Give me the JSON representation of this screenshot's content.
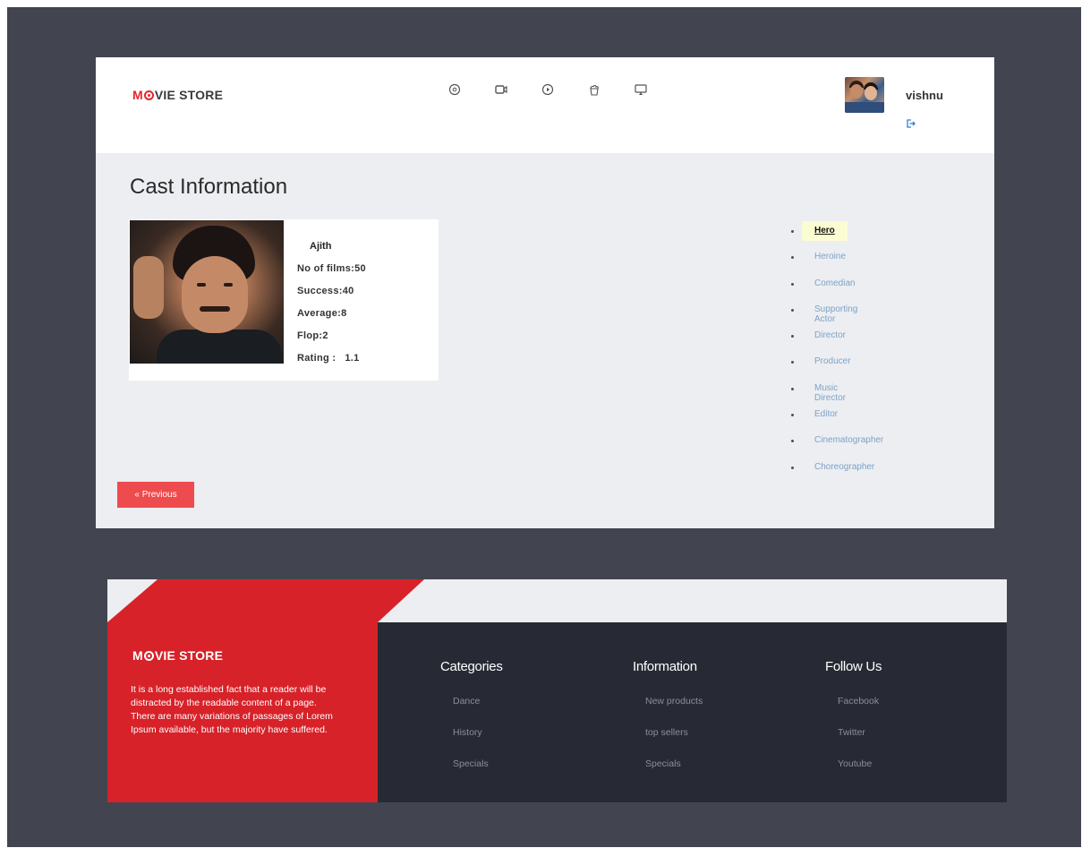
{
  "header": {
    "logo": {
      "m": "M",
      "rest": "VIE STORE"
    },
    "nav_icons": [
      "search-icon",
      "video-camera-icon",
      "play-icon",
      "popcorn-icon",
      "cast-screen-icon"
    ],
    "user": {
      "name": "vishnu",
      "logout_icon": "logout-icon"
    }
  },
  "page": {
    "title": "Cast Information"
  },
  "cast": {
    "name": "Ajith",
    "films": "No of films:50",
    "success": "Success:40",
    "average": "Average:8",
    "flop": "Flop:2",
    "rating_label": "Rating :",
    "rating_value": "1.1"
  },
  "roles": {
    "active": "Hero",
    "items": [
      "Heroine",
      "Comedian",
      "Supporting Actor",
      "Director",
      "Producer",
      "Music Director",
      "Editor",
      "Cinematographer",
      "Choreographer"
    ]
  },
  "buttons": {
    "previous": "« Previous"
  },
  "footer": {
    "logo": {
      "m": "M",
      "rest": "VIE STORE"
    },
    "about": [
      "It is a long established fact that a reader will be distracted by the readable content of a page.",
      "There are many variations of passages of Lorem Ipsum available, but the majority have suffered."
    ],
    "columns": [
      {
        "title": "Categories",
        "links": [
          "Dance",
          "History",
          "Specials"
        ]
      },
      {
        "title": "Information",
        "links": [
          "New products",
          "top sellers",
          "Specials"
        ]
      },
      {
        "title": "Follow Us",
        "links": [
          "Facebook",
          "Twitter",
          "Youtube"
        ]
      }
    ]
  },
  "colors": {
    "page_bg": "#42454f",
    "accent_red": "#d72229",
    "button_red": "#ee4b4e",
    "footer_dark": "#272a34",
    "link_blue": "#7ea2c8",
    "active_bg": "#fcfcd3"
  }
}
